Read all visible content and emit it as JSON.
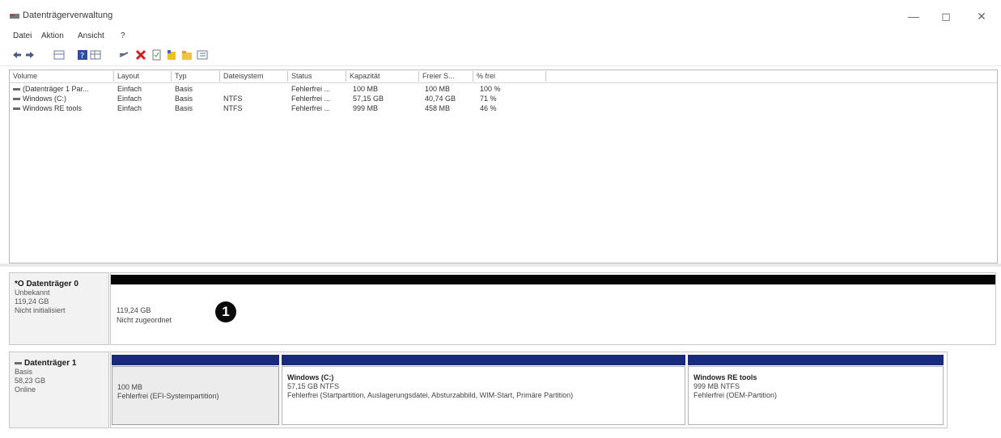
{
  "window": {
    "title": "Datenträgerverwaltung",
    "buttons": {
      "minimize": "—",
      "maximize": "◻",
      "close": "✕"
    }
  },
  "menu": [
    "Datei",
    "Aktion",
    "Ansicht",
    "?"
  ],
  "toolbar_icons": [
    "back-icon",
    "forward-icon",
    "grid-icon",
    "help-icon",
    "grid2-icon",
    "connect-icon",
    "delete-icon",
    "doc-icon",
    "yellow-square-icon",
    "folder-icon",
    "list-icon"
  ],
  "volume_list": {
    "columns": [
      "Volume",
      "Layout",
      "Typ",
      "Dateisystem",
      "Status",
      "Kapazität",
      "Freier S...",
      "% frei"
    ],
    "rows": [
      [
        "(Datenträger 1 Par...",
        "Einfach",
        "Basis",
        "",
        "Fehlerfrei ...",
        "100 MB",
        "100 MB",
        "100 %"
      ],
      [
        "Windows (C:)",
        "Einfach",
        "Basis",
        "NTFS",
        "Fehlerfrei ...",
        "57,15 GB",
        "40,74 GB",
        "71 %"
      ],
      [
        "Windows RE tools",
        "Einfach",
        "Basis",
        "NTFS",
        "Fehlerfrei ...",
        "999 MB",
        "458 MB",
        "46 %"
      ]
    ]
  },
  "disk0": {
    "name": "*O Datenträger 0",
    "type": "Unbekannt",
    "size": "119,24 GB",
    "state": "Nicht initialisiert",
    "area_size": "119,24 GB",
    "area_status": "Nicht zugeordnet",
    "badge": "1"
  },
  "disk1": {
    "name": "Datenträger 1",
    "type": "Basis",
    "size": "58,23 GB",
    "state": "Online",
    "partitions": [
      {
        "title": "",
        "size": "100 MB",
        "status": "Fehlerfrei (EFI-Systempartition)"
      },
      {
        "title": "Windows  (C:)",
        "size": "57,15 GB NTFS",
        "status": "Fehlerfrei (Startpartition, Auslagerungsdatei, Absturzabbild, WIM-Start, Primäre Partition)"
      },
      {
        "title": "Windows RE tools",
        "size": "999 MB NTFS",
        "status": "Fehlerfrei (OEM-Partition)"
      }
    ]
  },
  "colors": {
    "unallocated_bar": "#050505",
    "partition_bar": "#1a2a7a"
  }
}
